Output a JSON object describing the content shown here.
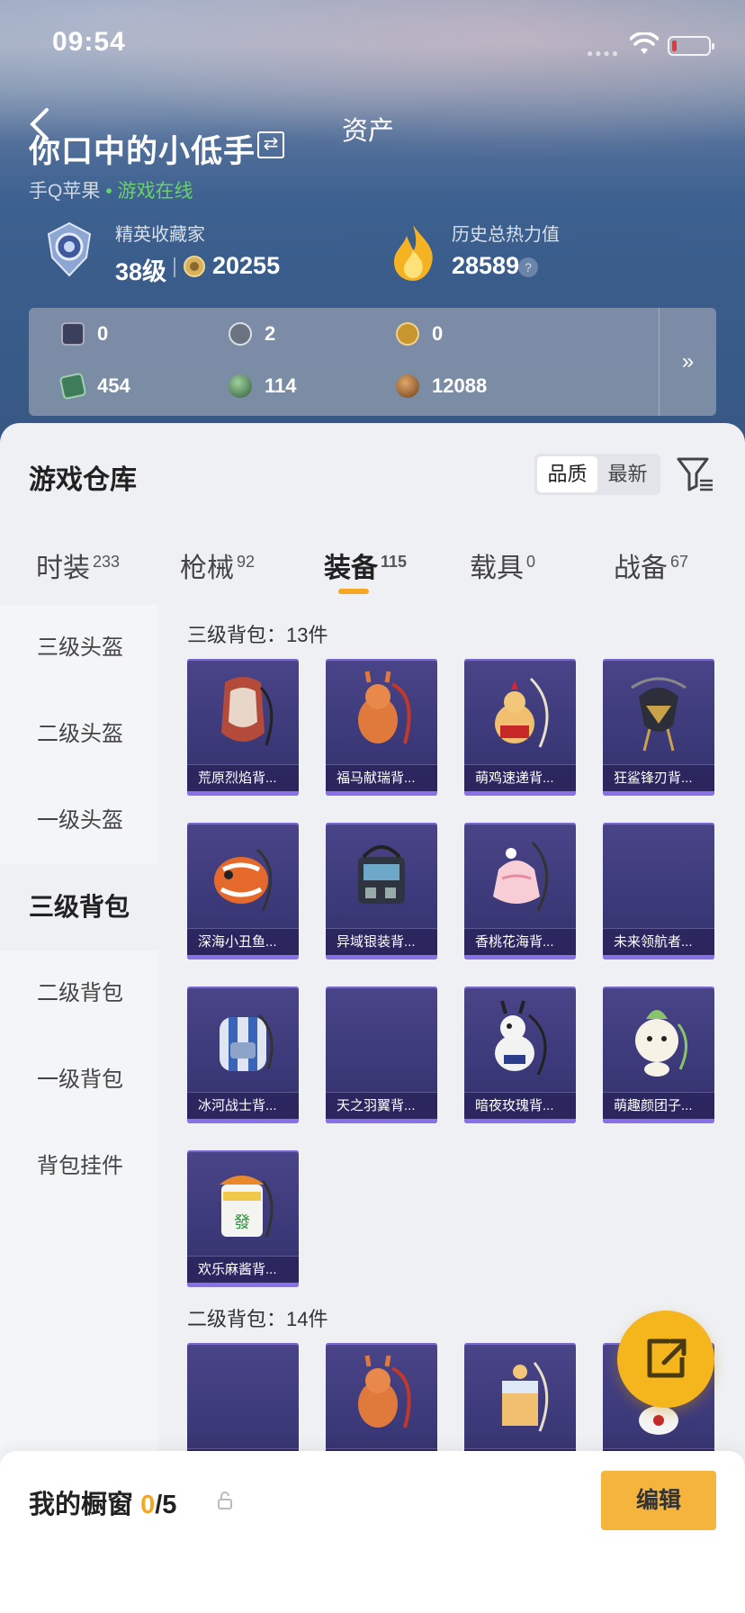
{
  "status_bar": {
    "time": "09:54"
  },
  "header": {
    "title": "资产",
    "username": "你口中的小低手",
    "platform": "手Q苹果",
    "online_status": "• 游戏在线"
  },
  "profile": {
    "rank_title": "精英收藏家",
    "level": "38级",
    "coins": "20255",
    "heat_label": "历史总热力值",
    "heat_value": "28589",
    "heat_help": "?"
  },
  "resources": [
    {
      "icon": "card-icon",
      "value": "0",
      "color": "#3a3f5c"
    },
    {
      "icon": "silver-coin-icon",
      "value": "2",
      "color": "#6b7280"
    },
    {
      "icon": "gold-coin-icon",
      "value": "0",
      "color": "#c9952e"
    },
    {
      "icon": "ticket-icon",
      "value": "454",
      "color": "#3f7d5a"
    },
    {
      "icon": "green-orb-icon",
      "value": "114",
      "color": "#4a7a52"
    },
    {
      "icon": "bronze-medal-icon",
      "value": "12088",
      "color": "#8a5a2e"
    }
  ],
  "warehouse": {
    "title": "游戏仓库",
    "sort_options": [
      "品质",
      "最新"
    ],
    "tabs": [
      {
        "label": "时装",
        "count": "233"
      },
      {
        "label": "枪械",
        "count": "92"
      },
      {
        "label": "装备",
        "count": "115"
      },
      {
        "label": "载具",
        "count": "0"
      },
      {
        "label": "战备",
        "count": "67"
      }
    ],
    "categories": [
      "三级头盔",
      "二级头盔",
      "一级头盔",
      "三级背包",
      "二级背包",
      "一级背包",
      "背包挂件"
    ],
    "sections": [
      {
        "title": "三级背包：13件",
        "items": [
          "荒原烈焰背...",
          "福马献瑞背...",
          "萌鸡速递背...",
          "狂鲨锋刃背...",
          "深海小丑鱼...",
          "异域银装背...",
          "香桃花海背...",
          "未来领航者...",
          "冰河战士背...",
          "天之羽翼背...",
          "暗夜玫瑰背...",
          "萌趣颜团子...",
          "欢乐麻酱背..."
        ]
      },
      {
        "title": "二级背包：14件",
        "items": [
          "",
          "",
          "",
          ""
        ]
      }
    ]
  },
  "showcase": {
    "title": "我的橱窗",
    "count": "0",
    "total": "/5",
    "edit_label": "编辑"
  },
  "colors": {
    "accent": "#f5a623",
    "card_bg": "#3c3a7a",
    "online": "#6ad06a"
  }
}
